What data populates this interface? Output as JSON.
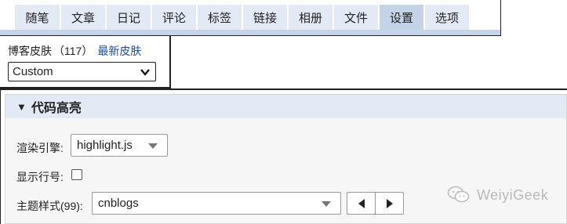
{
  "tabs": [
    {
      "label": "随笔",
      "active": false
    },
    {
      "label": "文章",
      "active": false
    },
    {
      "label": "日记",
      "active": false
    },
    {
      "label": "评论",
      "active": false
    },
    {
      "label": "标签",
      "active": false
    },
    {
      "label": "链接",
      "active": false
    },
    {
      "label": "相册",
      "active": false
    },
    {
      "label": "文件",
      "active": false
    },
    {
      "label": "设置",
      "active": true
    },
    {
      "label": "选项",
      "active": false
    }
  ],
  "skin": {
    "label": "博客皮肤",
    "count": "（117）",
    "latest_link": "最新皮肤",
    "selected": "Custom"
  },
  "code_highlight": {
    "section_title": "代码高亮",
    "engine_label": "渲染引擎:",
    "engine_value": "highlight.js",
    "line_numbers_label": "显示行号:",
    "line_numbers_checked": false,
    "theme_label": "主题样式(99):",
    "theme_value": "cnblogs"
  },
  "watermark": {
    "text": "WeiyiGeek"
  },
  "colors": {
    "tab_bg": "#e3eaf6",
    "tab_active_bg": "#c5d3e8",
    "tab_underline": "#c6d4ea",
    "link": "#1f4e9e",
    "section_header_bg": "#e4eaf5",
    "panel_bg": "#f6f6f6"
  }
}
